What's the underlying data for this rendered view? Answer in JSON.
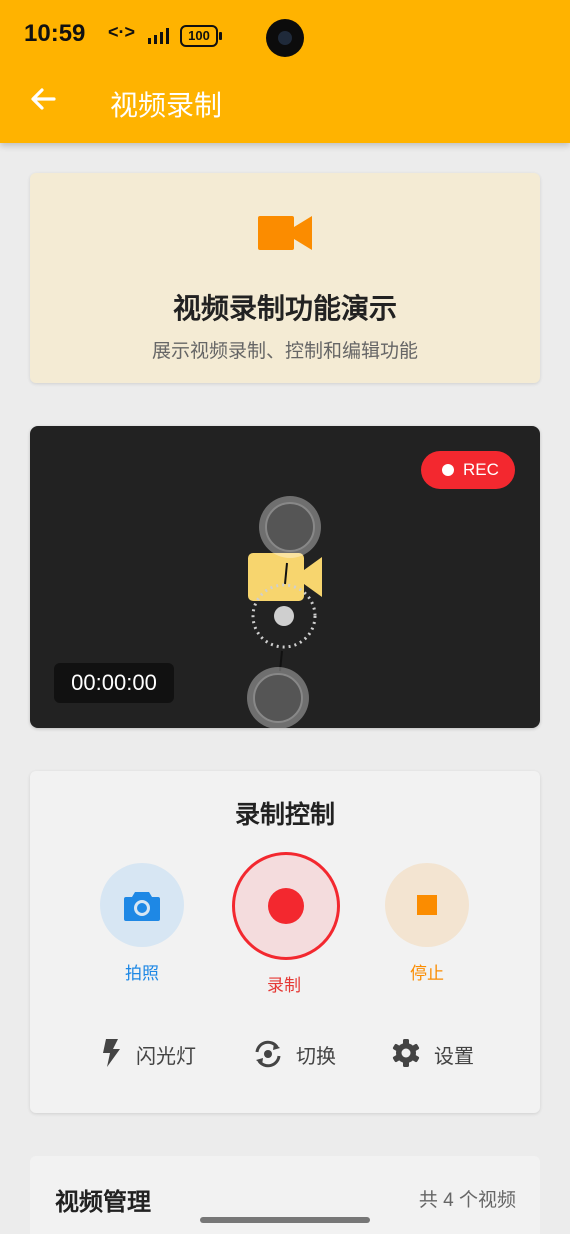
{
  "status_bar": {
    "time": "10:59",
    "signal": "<·>",
    "battery": "100"
  },
  "header": {
    "title": "视频录制",
    "back_icon": "arrow-left-icon",
    "color": "#FFB300"
  },
  "intro": {
    "icon": "videocam-icon",
    "title": "视频录制功能演示",
    "subtitle": "展示视频录制、控制和编辑功能"
  },
  "preview": {
    "rec_label": "REC",
    "timer": "00:00:00",
    "center_icon": "videocam-icon"
  },
  "controls": {
    "title": "录制控制",
    "photo_label": "拍照",
    "record_label": "录制",
    "stop_label": "停止",
    "options": [
      {
        "label": "闪光灯",
        "icon": "flash-icon"
      },
      {
        "label": "切换",
        "icon": "switch-camera-icon"
      },
      {
        "label": "设置",
        "icon": "gear-icon"
      }
    ]
  },
  "video_management": {
    "title": "视频管理",
    "count": "共 4 个视频"
  },
  "colors": {
    "accent": "#FFB300",
    "record": "#F3282F",
    "photo": "#1E88E5",
    "stop": "#FB8C00"
  }
}
